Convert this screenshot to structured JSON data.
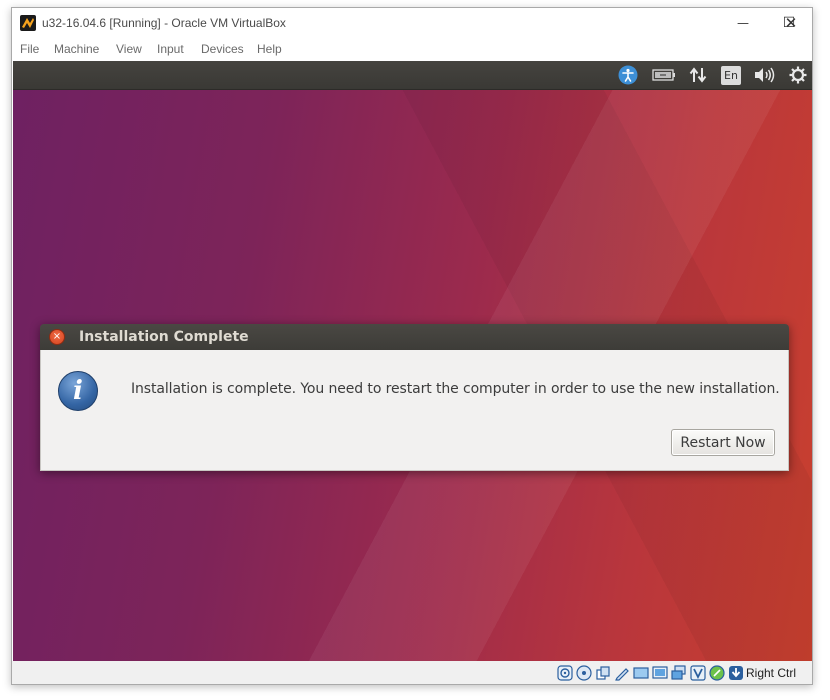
{
  "window": {
    "title": "u32-16.04.6 [Running] - Oracle VM VirtualBox",
    "minimize_glyph": "—",
    "maximize_glyph": "☐",
    "close_glyph": "✕"
  },
  "menu": {
    "items": [
      {
        "label": "File"
      },
      {
        "label": "Machine"
      },
      {
        "label": "View"
      },
      {
        "label": "Input"
      },
      {
        "label": "Devices"
      },
      {
        "label": "Help"
      }
    ]
  },
  "panel": {
    "icons": [
      "accessibility-icon",
      "battery-icon",
      "network-icon",
      "keyboard-layout-indicator",
      "volume-icon",
      "settings-gear-icon"
    ],
    "keyboard_layout": "En"
  },
  "dialog": {
    "title": "Installation Complete",
    "message": "Installation is complete. You need to restart the computer in order to use the new installation.",
    "button_label": "Restart Now",
    "info_glyph": "i"
  },
  "statusbar": {
    "icons": [
      "hard-disk-icon",
      "optical-drive-icon",
      "usb-icon",
      "shared-folders-icon",
      "display-icon",
      "video-capture-icon",
      "network-adapter-icon",
      "virtualization-icon",
      "mouse-integration-icon",
      "host-key-arrow-icon"
    ],
    "host_key": "Right Ctrl"
  },
  "colors": {
    "panel_bg": "#3c3b37",
    "dialog_close": "#df4a1f",
    "info_blue": "#3465a4",
    "wallpaper_left": "#6e2162",
    "wallpaper_right": "#c9402e"
  }
}
